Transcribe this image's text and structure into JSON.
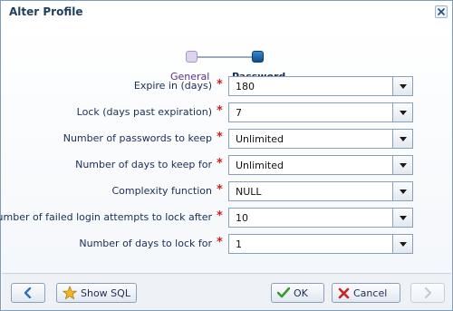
{
  "dialog": {
    "title": "Alter Profile"
  },
  "train": {
    "steps": [
      {
        "label": "General",
        "state": "visited",
        "color": "#553388"
      },
      {
        "label": "Password",
        "state": "current",
        "color": "#0b4f8a"
      }
    ]
  },
  "form": {
    "fields": [
      {
        "label": "Expire in (days)",
        "value": "180",
        "required": true
      },
      {
        "label": "Lock (days past expiration)",
        "value": "7",
        "required": true
      },
      {
        "label": "Number of passwords to keep",
        "value": "Unlimited",
        "required": true
      },
      {
        "label": "Number of days to keep for",
        "value": "Unlimited",
        "required": true
      },
      {
        "label": "Complexity function",
        "value": "NULL",
        "required": true
      },
      {
        "label": "Number of failed login attempts to lock after",
        "value": "10",
        "required": true
      },
      {
        "label": "Number of days to lock for",
        "value": "1",
        "required": true
      }
    ],
    "required_marker": "*"
  },
  "footer": {
    "back_icon": "arrow-left-icon",
    "show_sql_label": "Show SQL",
    "show_sql_icon": "star-icon",
    "ok_label": "OK",
    "ok_icon": "checkmark-icon",
    "cancel_label": "Cancel",
    "cancel_icon": "x-icon",
    "next_icon": "arrow-right-icon"
  },
  "colors": {
    "accent": "#0b4f8a",
    "required": "#cc2222",
    "ok_check": "#3a9a2a",
    "cancel_x": "#cc2222",
    "star": "#f2b820"
  }
}
